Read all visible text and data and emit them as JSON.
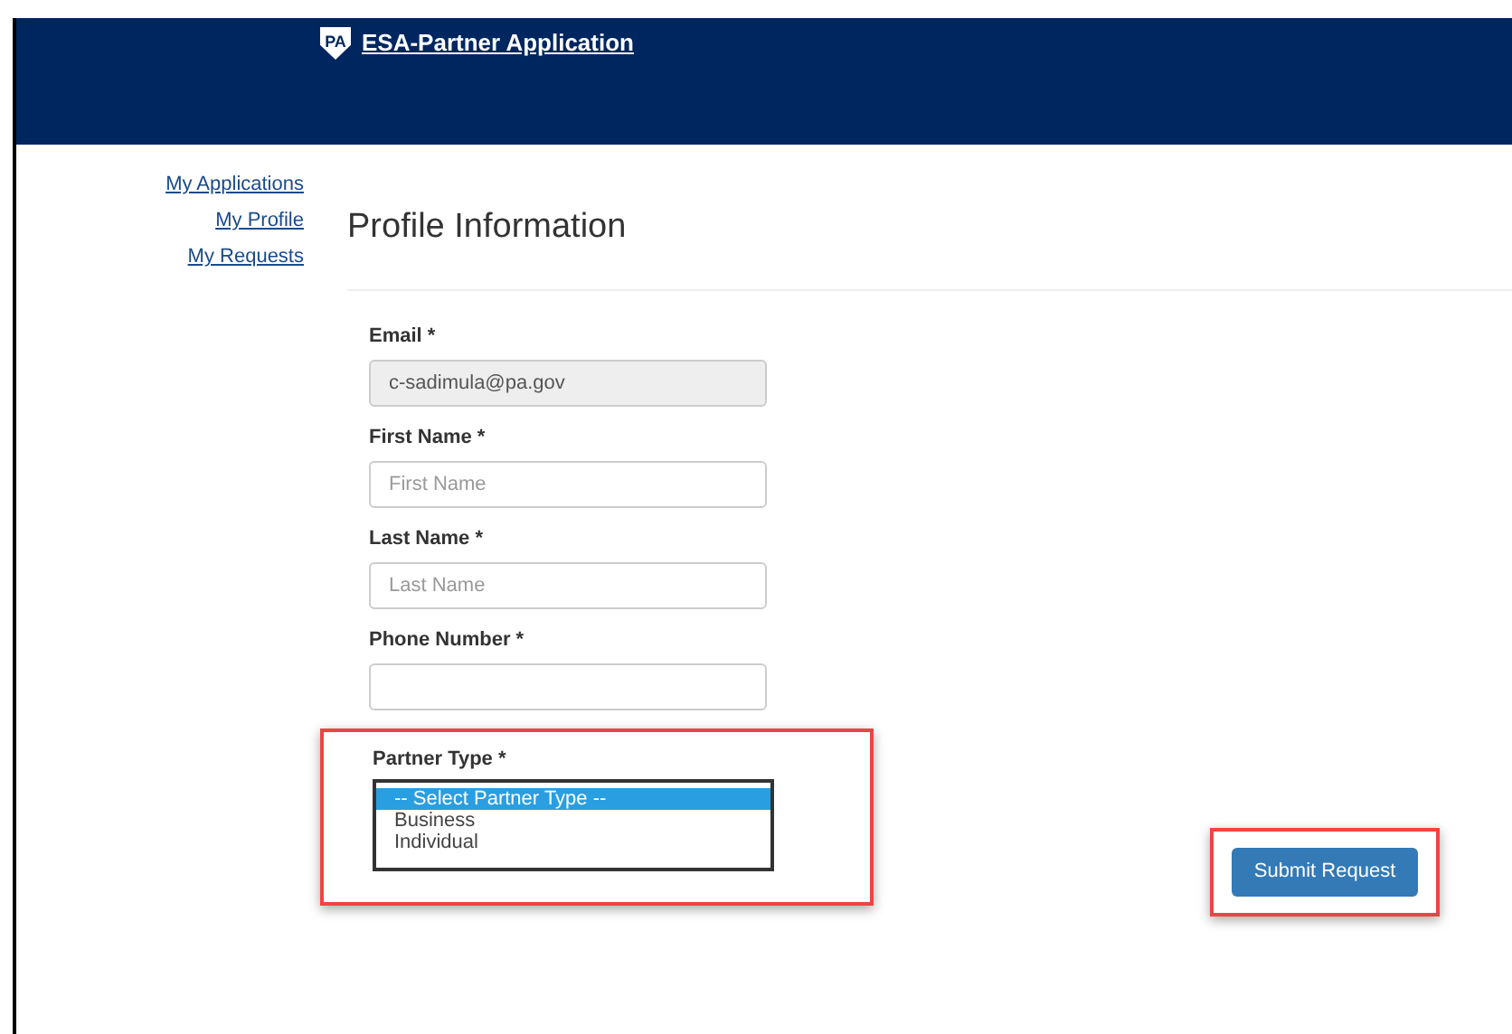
{
  "header": {
    "logo_text": "PA",
    "title": "ESA-Partner Application"
  },
  "sidebar": {
    "items": [
      {
        "label": "My Applications"
      },
      {
        "label": "My Profile"
      },
      {
        "label": "My Requests"
      }
    ]
  },
  "heading": "Profile Information",
  "fields": [
    {
      "label": "Email *",
      "value": "c-sadimula@pa.gov",
      "disabled": true
    },
    {
      "label": "First Name *",
      "placeholder": "First Name",
      "disabled": false
    },
    {
      "label": "Last Name *",
      "placeholder": "Last Name",
      "disabled": false
    },
    {
      "label": "Phone Number *",
      "disabled": false
    }
  ],
  "partner_type": {
    "label": "Partner Type *",
    "highlighted": true,
    "options": [
      {
        "label": "-- Select Partner Type --",
        "selected": true
      },
      {
        "label": "Business",
        "selected": false
      },
      {
        "label": "Individual",
        "selected": false
      }
    ]
  },
  "submit_button": {
    "label": "Submit Request",
    "highlighted": true
  }
}
